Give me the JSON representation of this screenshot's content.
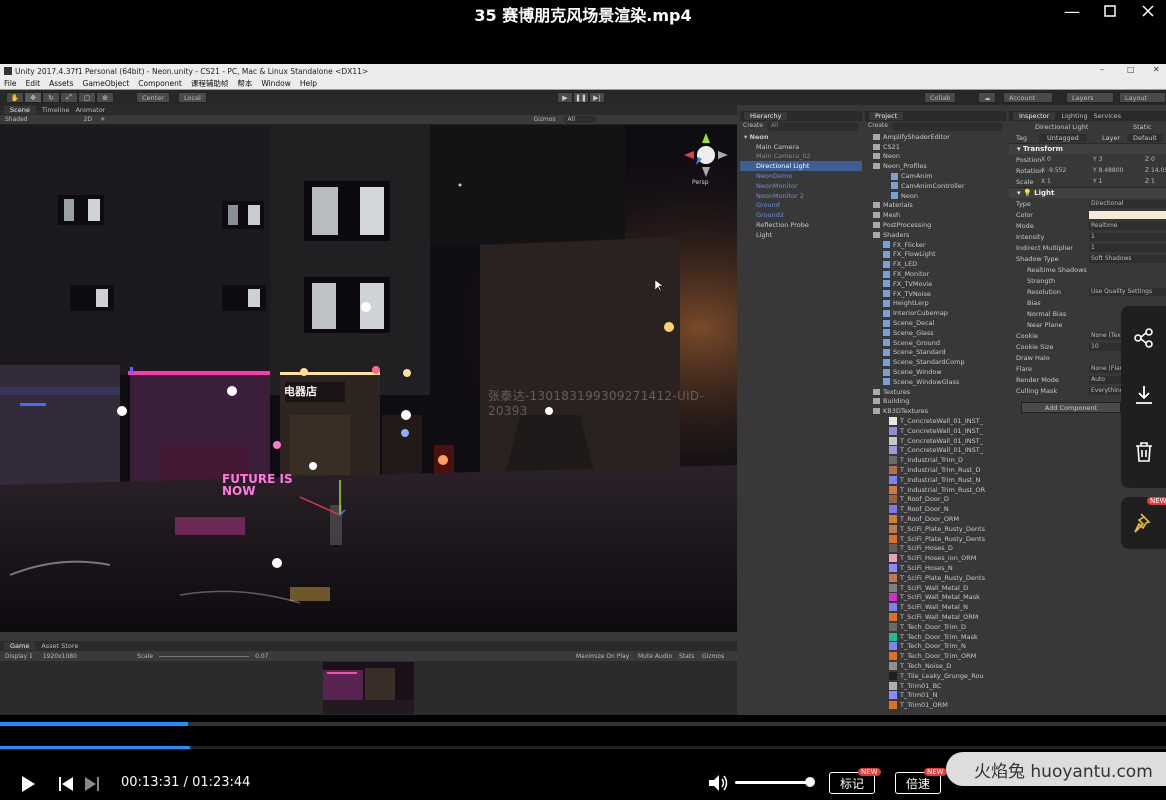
{
  "player": {
    "title": "35 赛博朋克风场景渲染.mp4",
    "current_time": "00:13:31",
    "total_time": "01:23:44",
    "time_separator": "/",
    "progress": 0.162,
    "volume": 1.0,
    "mark_label": "标记",
    "speed_label": "倍速",
    "new_badge": "NEW",
    "site_watermark": "火焰兔 huoyantu.com"
  },
  "unity": {
    "window_title": "Unity 2017.4.37f1 Personal (64bit) - Neon.unity - CS21 - PC, Mac & Linux Standalone <DX11>",
    "menu": [
      "File",
      "Edit",
      "Assets",
      "GameObject",
      "Component",
      "课程辅助帧",
      "帮本",
      "Window",
      "Help"
    ],
    "toolbar": {
      "center": "Center",
      "local": "Local",
      "collab": "Collab",
      "account": "Account",
      "layers": "Layers",
      "layout": "Layout"
    },
    "scene_tabs": [
      "Scene",
      "Timeline",
      "Animator"
    ],
    "scene_shading": "Shaded",
    "scene_2d": "2D",
    "gizmos": "Gizmos",
    "search_all": "All",
    "persp": "Persp",
    "scene_watermark": "张泰达-13018319930927141​2-UID-20393",
    "game_tabs": [
      "Game",
      "Asset Store"
    ],
    "game_display": "Display 1",
    "game_resolution": "1920x1080",
    "game_scale_label": "Scale",
    "game_scale_value": "0.07",
    "game_options": [
      "Maximize On Play",
      "Mute Audio",
      "Stats",
      "Gizmos"
    ],
    "hierarchy": {
      "tab": "Hierarchy",
      "create": "Create",
      "search": "All",
      "scene_name": "Neon",
      "items": [
        {
          "label": "Main Camera",
          "style": "normal"
        },
        {
          "label": "Main Camera_02",
          "style": "dim"
        },
        {
          "label": "Directional Light",
          "style": "selected"
        },
        {
          "label": "NeonDemo",
          "style": "blue"
        },
        {
          "label": "NeonMonitor",
          "style": "blue"
        },
        {
          "label": "NeonMonitor 2",
          "style": "blue"
        },
        {
          "label": "Ground",
          "style": "blue"
        },
        {
          "label": "Ground2",
          "style": "blue"
        },
        {
          "label": "Reflection Probe",
          "style": "normal"
        },
        {
          "label": "Light",
          "style": "normal"
        }
      ]
    },
    "project": {
      "tab": "Project",
      "create": "Create",
      "items": [
        {
          "label": "AmplifyShaderEditor",
          "icon": "folder"
        },
        {
          "label": "CS21",
          "icon": "folder"
        },
        {
          "label": "Neon",
          "icon": "folder"
        },
        {
          "label": "Neon_Profiles",
          "icon": "folder"
        },
        {
          "label": "CamAnim",
          "icon": "anim"
        },
        {
          "label": "CamAnimController",
          "icon": "anim"
        },
        {
          "label": "Neon",
          "icon": "unity"
        },
        {
          "label": "Materials",
          "icon": "folder"
        },
        {
          "label": "Mesh",
          "icon": "folder"
        },
        {
          "label": "PostProcessing",
          "icon": "folder"
        },
        {
          "label": "Shaders",
          "icon": "folder"
        },
        {
          "label": "FX_Flicker",
          "icon": "shader"
        },
        {
          "label": "FX_FlowLight",
          "icon": "shader"
        },
        {
          "label": "FX_LED",
          "icon": "shader"
        },
        {
          "label": "FX_Monitor",
          "icon": "shader"
        },
        {
          "label": "FX_TVMovie",
          "icon": "shader"
        },
        {
          "label": "FX_TVNoise",
          "icon": "shader"
        },
        {
          "label": "HeightLerp",
          "icon": "func"
        },
        {
          "label": "InteriorCubemap",
          "icon": "func"
        },
        {
          "label": "Scene_Decal",
          "icon": "shader"
        },
        {
          "label": "Scene_Glass",
          "icon": "shader"
        },
        {
          "label": "Scene_Ground",
          "icon": "shader"
        },
        {
          "label": "Scene_Standard",
          "icon": "shader"
        },
        {
          "label": "Scene_StandardComp",
          "icon": "shader"
        },
        {
          "label": "Scene_Window",
          "icon": "shader"
        },
        {
          "label": "Scene_WindowGlass",
          "icon": "shader"
        },
        {
          "label": "Textures",
          "icon": "folder"
        },
        {
          "label": "Building",
          "icon": "folder"
        },
        {
          "label": "KB3DTextures",
          "icon": "folder"
        },
        {
          "label": "T_ConcreteWall_01_INST_",
          "icon": "tex",
          "color": "#e8e8e8"
        },
        {
          "label": "T_ConcreteWall_01_INST_",
          "icon": "tex",
          "color": "#8a8fd0"
        },
        {
          "label": "T_ConcreteWall_01_INST_",
          "icon": "tex",
          "color": "#c8c8c8"
        },
        {
          "label": "T_ConcreteWall_01_INST_",
          "icon": "tex",
          "color": "#9a9ae0"
        },
        {
          "label": "T_Industrial_Trim_D",
          "icon": "tex",
          "color": "#6a6a6a"
        },
        {
          "label": "T_Industrial_Trim_Rust_D",
          "icon": "tex",
          "color": "#b07050"
        },
        {
          "label": "T_Industrial_Trim_Rust_N",
          "icon": "tex",
          "color": "#8080ff"
        },
        {
          "label": "T_Industrial_Trim_Rust_OR",
          "icon": "tex",
          "color": "#d07840"
        },
        {
          "label": "T_Roof_Door_D",
          "icon": "tex",
          "color": "#a06040"
        },
        {
          "label": "T_Roof_Door_N",
          "icon": "tex",
          "color": "#7a7aee"
        },
        {
          "label": "T_Roof_Door_ORM",
          "icon": "tex",
          "color": "#d08030"
        },
        {
          "label": "T_SciFi_Plate_Rusty_Dents",
          "icon": "tex",
          "color": "#c07a50"
        },
        {
          "label": "T_SciFi_Plate_Rusty_Dents",
          "icon": "tex",
          "color": "#e07020"
        },
        {
          "label": "T_SciFi_Hoses_D",
          "icon": "tex",
          "color": "#606060"
        },
        {
          "label": "T_SciFi_Hoses_ion_ORM",
          "icon": "tex",
          "color": "#e0a0c0"
        },
        {
          "label": "T_SciFi_Hoses_N",
          "icon": "tex",
          "color": "#8a8aff"
        },
        {
          "label": "T_SciFi_Plate_Rusty_Dents",
          "icon": "tex",
          "color": "#c07a50"
        },
        {
          "label": "T_SciFi_Wall_Metal_D",
          "icon": "tex",
          "color": "#808080"
        },
        {
          "label": "T_SciFi_Wall_Metal_Mask",
          "icon": "tex",
          "color": "#d030d0"
        },
        {
          "label": "T_SciFi_Wall_Metal_N",
          "icon": "tex",
          "color": "#8080f0"
        },
        {
          "label": "T_SciFi_Wall_Metal_ORM",
          "icon": "tex",
          "color": "#e07020"
        },
        {
          "label": "T_Tech_Door_Trim_D",
          "icon": "tex",
          "color": "#6a6a6a"
        },
        {
          "label": "T_Tech_Door_Trim_Mask",
          "icon": "tex",
          "color": "#20c080"
        },
        {
          "label": "T_Tech_Door_Trim_N",
          "icon": "tex",
          "color": "#8080ff"
        },
        {
          "label": "T_Tech_Door_Trim_ORM",
          "icon": "tex",
          "color": "#e07020"
        },
        {
          "label": "T_Tech_Noise_D",
          "icon": "tex",
          "color": "#909090"
        },
        {
          "label": "T_Tile_Leaky_Grunge_Rou",
          "icon": "tex",
          "color": "#202020"
        },
        {
          "label": "T_Trim01_BC",
          "icon": "tex",
          "color": "#b0b0b0"
        },
        {
          "label": "T_Trim01_N",
          "icon": "tex",
          "color": "#8a8aff"
        },
        {
          "label": "T_Trim01_ORM",
          "icon": "tex",
          "color": "#e07020"
        }
      ]
    },
    "inspector": {
      "tabs": [
        "Inspector",
        "Lighting",
        "Services"
      ],
      "object_name": "Directional Light",
      "static": "Static",
      "tag_label": "Tag",
      "tag_value": "Untagged",
      "layer_label": "Layer",
      "layer_value": "Default",
      "transform_header": "Transform",
      "transform": [
        {
          "label": "Position",
          "x": "0",
          "y": "3",
          "z": "0"
        },
        {
          "label": "Rotation",
          "x": "-9.552",
          "y": "8.48800",
          "z": "14.054"
        },
        {
          "label": "Scale",
          "x": "1",
          "y": "1",
          "z": "1"
        }
      ],
      "light_header": "Light",
      "light_props": [
        {
          "label": "Type",
          "value": "Directional"
        },
        {
          "label": "Color",
          "value": ""
        },
        {
          "label": "Mode",
          "value": "Realtime"
        },
        {
          "label": "Intensity",
          "value": "1"
        },
        {
          "label": "Indirect Multiplier",
          "value": "1"
        },
        {
          "label": "Shadow Type",
          "value": "Soft Shadows"
        },
        {
          "label": "Realtime Shadows",
          "value": ""
        },
        {
          "label": "Strength",
          "value": ""
        },
        {
          "label": "Resolution",
          "value": "Use Quality Settings"
        },
        {
          "label": "Bias",
          "value": ""
        },
        {
          "label": "Normal Bias",
          "value": ""
        },
        {
          "label": "Near Plane",
          "value": ""
        },
        {
          "label": "Cookie",
          "value": "None (Texture)"
        },
        {
          "label": "Cookie Size",
          "value": "10"
        },
        {
          "label": "Draw Halo",
          "value": ""
        },
        {
          "label": "Flare",
          "value": "None (Flare)"
        },
        {
          "label": "Render Mode",
          "value": "Auto"
        },
        {
          "label": "Culling Mask",
          "value": "Everything"
        }
      ],
      "light_color": "#f4ecd8",
      "add_component": "Add Component"
    },
    "neon_sign_1": "电器店",
    "neon_sign_2": "FUTURE IS NOW",
    "neon_sign_3": "电器店"
  }
}
